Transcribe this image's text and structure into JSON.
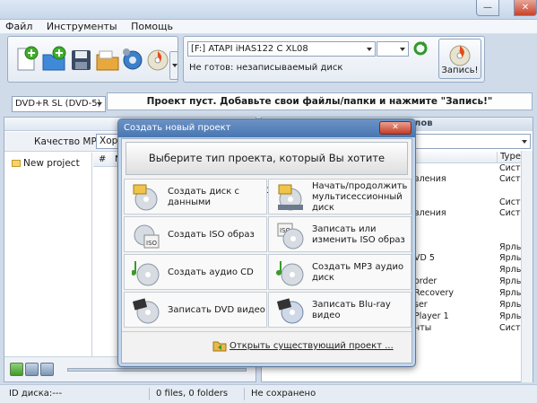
{
  "window": {
    "controls": {
      "minimize": "—",
      "maximize": "▭",
      "close": "✕"
    }
  },
  "menu": [
    "Файл",
    "Инструменты",
    "Помощь"
  ],
  "toolbar": {
    "icons": [
      "new-project-icon",
      "add-folder-icon",
      "save-icon",
      "open-folder-icon",
      "settings-icon",
      "burn-disc-icon"
    ]
  },
  "drive": {
    "selected": "[F:] ATAPI iHAS122   C XL08",
    "status": "Не готов: незаписываемый диск",
    "burn_label": "Запись!"
  },
  "disc_type": "DVD+R SL (DVD-5)",
  "banner": "Проект пуст. Добавьте свои файлы/папки и нажмите \"Запись!\"",
  "left_panel": {
    "mp3_quality_label": "Качество MP3:",
    "mp3_quality_value": "Хоро",
    "tree_root": "New project",
    "grid_col_num": "#",
    "grid_col_n": "N"
  },
  "right_panel": {
    "header_fragment": "лов",
    "type_header": "Type",
    "rows": [
      {
        "name": "",
        "type": "Систе"
      },
      {
        "name": "вления",
        "type": "Систе"
      },
      {
        "name": "",
        "type": "Систе"
      },
      {
        "name": "вления",
        "type": "Систе"
      },
      {
        "name": "",
        "type": "Ярлык"
      },
      {
        "name": "VD 5",
        "type": "Ярлык"
      },
      {
        "name": "",
        "type": "Ярлык"
      },
      {
        "name": "order",
        "type": "Ярлык"
      },
      {
        "name": "Recovery",
        "type": "Ярлык"
      },
      {
        "name": "ser",
        "type": "Ярлык"
      },
      {
        "name": "Player 1",
        "type": "Ярлык"
      },
      {
        "name": "нты",
        "type": "Систе"
      }
    ]
  },
  "status_bar": {
    "disc_id": "ID диска:---",
    "files": "0 files, 0 folders",
    "saved": "Не сохранено"
  },
  "dialog": {
    "title": "Создать новый проект",
    "close": "✕",
    "question": "Выберите тип проекта, который Вы хотите запустить",
    "options": [
      {
        "label": "Создать диск с данными",
        "icon": "data-disc-icon"
      },
      {
        "label": "Начать/продолжить мультисессионный диск",
        "icon": "multisession-disc-icon"
      },
      {
        "label": "Создать ISO образ",
        "icon": "iso-image-icon"
      },
      {
        "label": "Записать или изменить ISO образ",
        "icon": "burn-iso-icon"
      },
      {
        "label": "Создать аудио CD",
        "icon": "audio-cd-icon"
      },
      {
        "label": "Создать MP3 аудио диск",
        "icon": "mp3-disc-icon"
      },
      {
        "label": "Записать DVD видео",
        "icon": "dvd-video-icon"
      },
      {
        "label": "Записать Blu-ray видео",
        "icon": "bluray-video-icon"
      }
    ],
    "open_existing": "Открыть существующий проект ..."
  }
}
